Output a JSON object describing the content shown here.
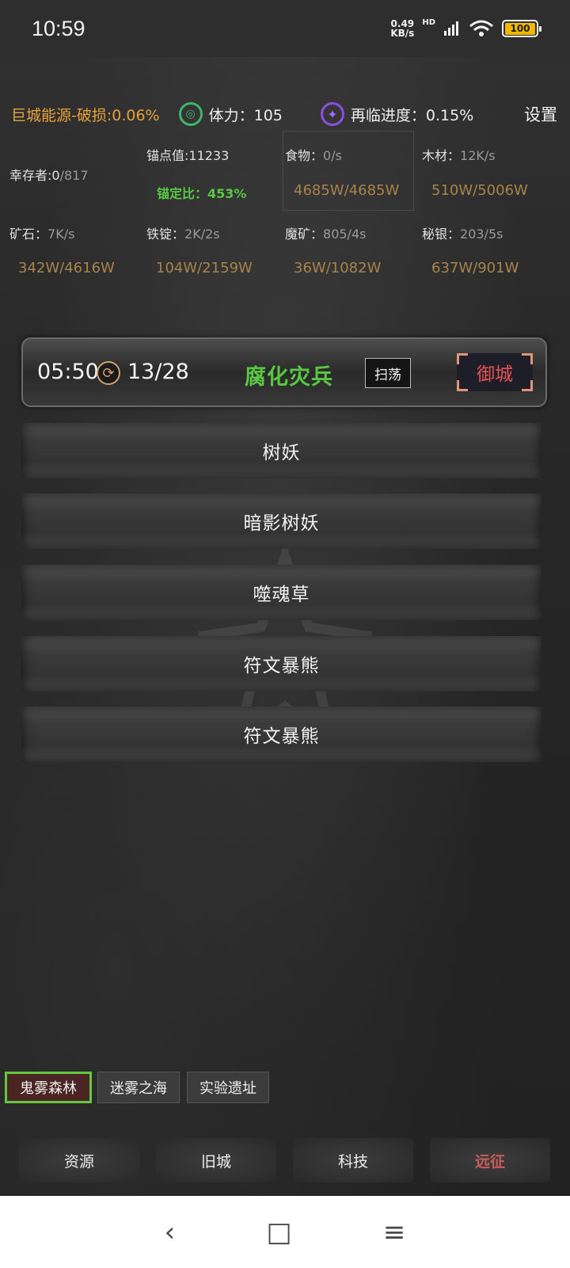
{
  "status": {
    "time": "10:59",
    "net_speed_value": "0.49",
    "net_speed_unit": "KB/s",
    "hd": "HD",
    "battery": "100"
  },
  "header": {
    "energy": "巨城能源-破损:0.06%",
    "stamina": "体力：105",
    "progress": "再临进度：0.15%",
    "settings": "设置"
  },
  "resources": {
    "survivors_label": "幸存者:0",
    "survivors_cap": "/817",
    "anchor_value": "锚点值:11233",
    "anchor_ratio": "锚定比：453%",
    "food_label": "食物：",
    "food_rate": "0/s",
    "food_value": "4685W/4685W",
    "wood_label": "木材：",
    "wood_rate": "12K/s",
    "wood_value": "510W/5006W",
    "ore_label": "矿石：",
    "ore_rate": "7K/s",
    "ore_value": "342W/4616W",
    "iron_label": "铁锭：",
    "iron_rate": "2K/2s",
    "iron_value": "104W/2159W",
    "magic_label": "魔矿：",
    "magic_rate": "805/4s",
    "magic_value": "36W/1082W",
    "mithril_label": "秘银：",
    "mithril_rate": "203/5s",
    "mithril_value": "637W/901W"
  },
  "boss": {
    "timer": "05:50",
    "count": "13/28",
    "name": "腐化灾兵",
    "sweep": "扫荡",
    "defend": "御城"
  },
  "monsters": [
    "树妖",
    "暗影树妖",
    "噬魂草",
    "符文暴熊",
    "符文暴熊"
  ],
  "zones": [
    "鬼雾森林",
    "迷雾之海",
    "实验遗址"
  ],
  "nav": [
    "资源",
    "旧城",
    "科技",
    "远征"
  ],
  "system_nav": {
    "back": "‹",
    "home": "□",
    "menu": "≡"
  }
}
